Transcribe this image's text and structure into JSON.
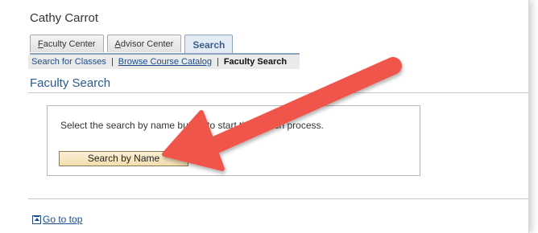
{
  "user": {
    "name": "Cathy Carrot"
  },
  "tabs": [
    {
      "label_first": "F",
      "label_rest": "aculty Center",
      "active": false
    },
    {
      "label_first": "A",
      "label_rest": "dvisor Center",
      "active": false
    },
    {
      "label": "Search",
      "active": true
    }
  ],
  "subnav": {
    "search_classes": "Search for Classes",
    "browse_catalog": "Browse Course Catalog",
    "faculty_search": "Faculty Search",
    "separator": "|"
  },
  "page": {
    "title": "Faculty Search"
  },
  "search": {
    "instruction": "Select the search by name button to start the search process.",
    "button_label": "Search by Name"
  },
  "footer": {
    "go_to_top": "Go to top"
  },
  "annotation": {
    "arrow_color": "#f0554b"
  }
}
